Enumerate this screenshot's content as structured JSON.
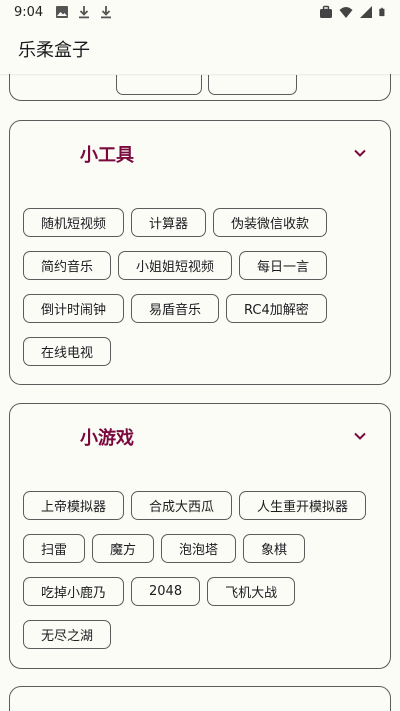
{
  "status_bar": {
    "time": "9:04",
    "left_icons": [
      "image-icon",
      "download-icon",
      "download-icon"
    ],
    "right_icons": [
      "briefcase-icon",
      "wifi-icon",
      "signal-icon",
      "battery-icon"
    ]
  },
  "app_bar": {
    "title": "乐柔盒子"
  },
  "colors": {
    "accent": "#7a0a3e",
    "background": "#fcfcf6",
    "outline": "#5c5c5c"
  },
  "sections": [
    {
      "title": "小工具",
      "items": [
        "随机短视频",
        "计算器",
        "伪装微信收款",
        "简约音乐",
        "小姐姐短视频",
        "每日一言",
        "倒计时闹钟",
        "易盾音乐",
        "RC4加解密",
        "在线电视"
      ]
    },
    {
      "title": "小游戏",
      "items": [
        "上帝模拟器",
        "合成大西瓜",
        "人生重开模拟器",
        "扫雷",
        "魔方",
        "泡泡塔",
        "象棋",
        "吃掉小鹿乃",
        "2048",
        "飞机大战",
        "无尽之湖"
      ]
    }
  ]
}
